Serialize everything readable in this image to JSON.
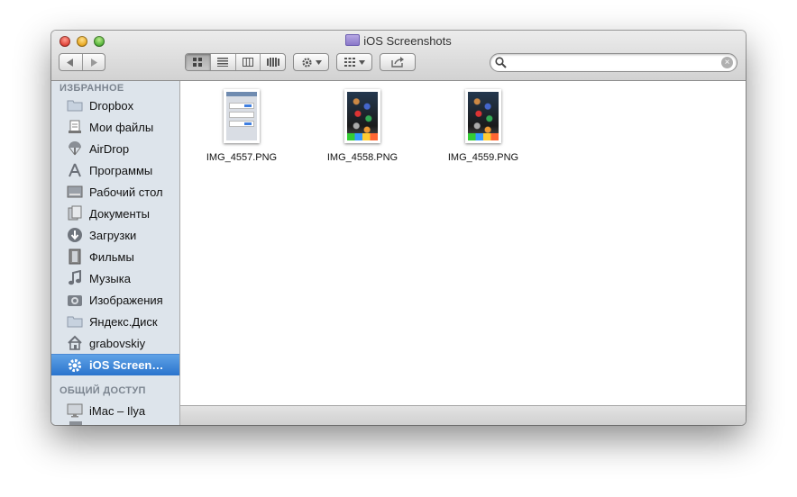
{
  "window": {
    "title": "iOS Screenshots"
  },
  "toolbar": {
    "back_icon": "chevron-left-icon",
    "forward_icon": "chevron-right-icon",
    "view_modes": [
      "icon-view",
      "list-view",
      "column-view",
      "coverflow-view"
    ],
    "active_view": "icon-view",
    "action_icon": "gear-icon",
    "arrange_icon": "grid-icon",
    "share_icon": "share-icon"
  },
  "search": {
    "value": "",
    "placeholder": ""
  },
  "sidebar": {
    "favorites_header": "ИЗБРАННОЕ",
    "favorites": [
      {
        "label": "Dropbox",
        "icon": "folder-icon"
      },
      {
        "label": "Мои файлы",
        "icon": "all-files-icon"
      },
      {
        "label": "AirDrop",
        "icon": "airdrop-icon"
      },
      {
        "label": "Программы",
        "icon": "applications-icon"
      },
      {
        "label": "Рабочий стол",
        "icon": "desktop-icon"
      },
      {
        "label": "Документы",
        "icon": "documents-icon"
      },
      {
        "label": "Загрузки",
        "icon": "downloads-icon"
      },
      {
        "label": "Фильмы",
        "icon": "movies-icon"
      },
      {
        "label": "Музыка",
        "icon": "music-icon"
      },
      {
        "label": "Изображения",
        "icon": "camera-icon"
      },
      {
        "label": "Яндекс.Диск",
        "icon": "folder-icon"
      },
      {
        "label": "grabovskiy",
        "icon": "home-icon"
      },
      {
        "label": "iOS Screen…",
        "icon": "gear-icon",
        "selected": true
      }
    ],
    "shared_header": "ОБЩИЙ ДОСТУП",
    "shared": [
      {
        "label": "iMac – Ilya",
        "icon": "imac-icon"
      }
    ]
  },
  "files": [
    {
      "name": "IMG_4557.PNG",
      "thumb": "settings-screen"
    },
    {
      "name": "IMG_4558.PNG",
      "thumb": "home-screen"
    },
    {
      "name": "IMG_4559.PNG",
      "thumb": "home-screen"
    }
  ]
}
